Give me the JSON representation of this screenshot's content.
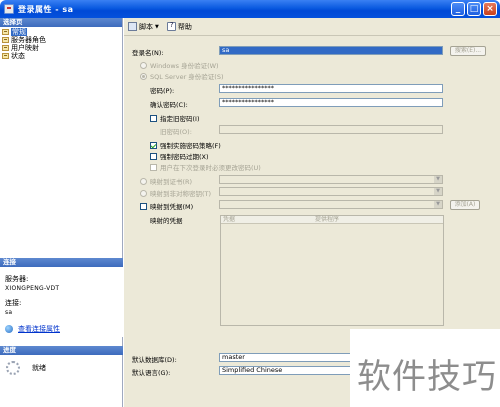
{
  "window": {
    "title": "登录属性 - sa"
  },
  "left": {
    "select_page_header": "选择页",
    "pages": [
      {
        "label": "常规",
        "selected": true
      },
      {
        "label": "服务器角色",
        "selected": false
      },
      {
        "label": "用户映射",
        "selected": false
      },
      {
        "label": "状态",
        "selected": false
      }
    ],
    "connection_header": "连接",
    "server_label": "服务器:",
    "server_value": "XIONGPENG-VDT",
    "connection_label": "连接:",
    "connection_value": "sa",
    "view_conn_props": "查看连接属性",
    "progress_header": "进度",
    "progress_status": "就绪"
  },
  "toolbar": {
    "script_label": "脚本",
    "help_label": "帮助"
  },
  "form": {
    "login_name_label": "登录名(N):",
    "login_name_value": "sa",
    "search_button": "搜索(E)...",
    "windows_auth": "Windows 身份验证(W)",
    "sql_auth": "SQL Server 身份验证(S)",
    "password_label": "密码(P):",
    "password_value": "****************",
    "confirm_label": "确认密码(C):",
    "confirm_value": "****************",
    "specify_old": "指定旧密码(I)",
    "old_password_label": "旧密码(O):",
    "enforce_policy": "强制实施密码策略(F)",
    "enforce_expiration": "强制密码过期(X)",
    "must_change": "用户在下次登录时必须更改密码(U)",
    "map_cert": "映射到证书(R)",
    "map_asym_key": "映射到非对称密钥(T)",
    "map_credential": "映射到凭据(M)",
    "add_button": "添加(A)",
    "mapped_credentials_label": "映射的凭据",
    "cred_columns": [
      "凭据",
      "提供程序"
    ],
    "default_db_label": "默认数据库(D):",
    "default_db_value": "master",
    "default_lang_label": "默认语言(G):",
    "default_lang_value": "Simplified Chinese"
  },
  "watermark": "软件技巧"
}
